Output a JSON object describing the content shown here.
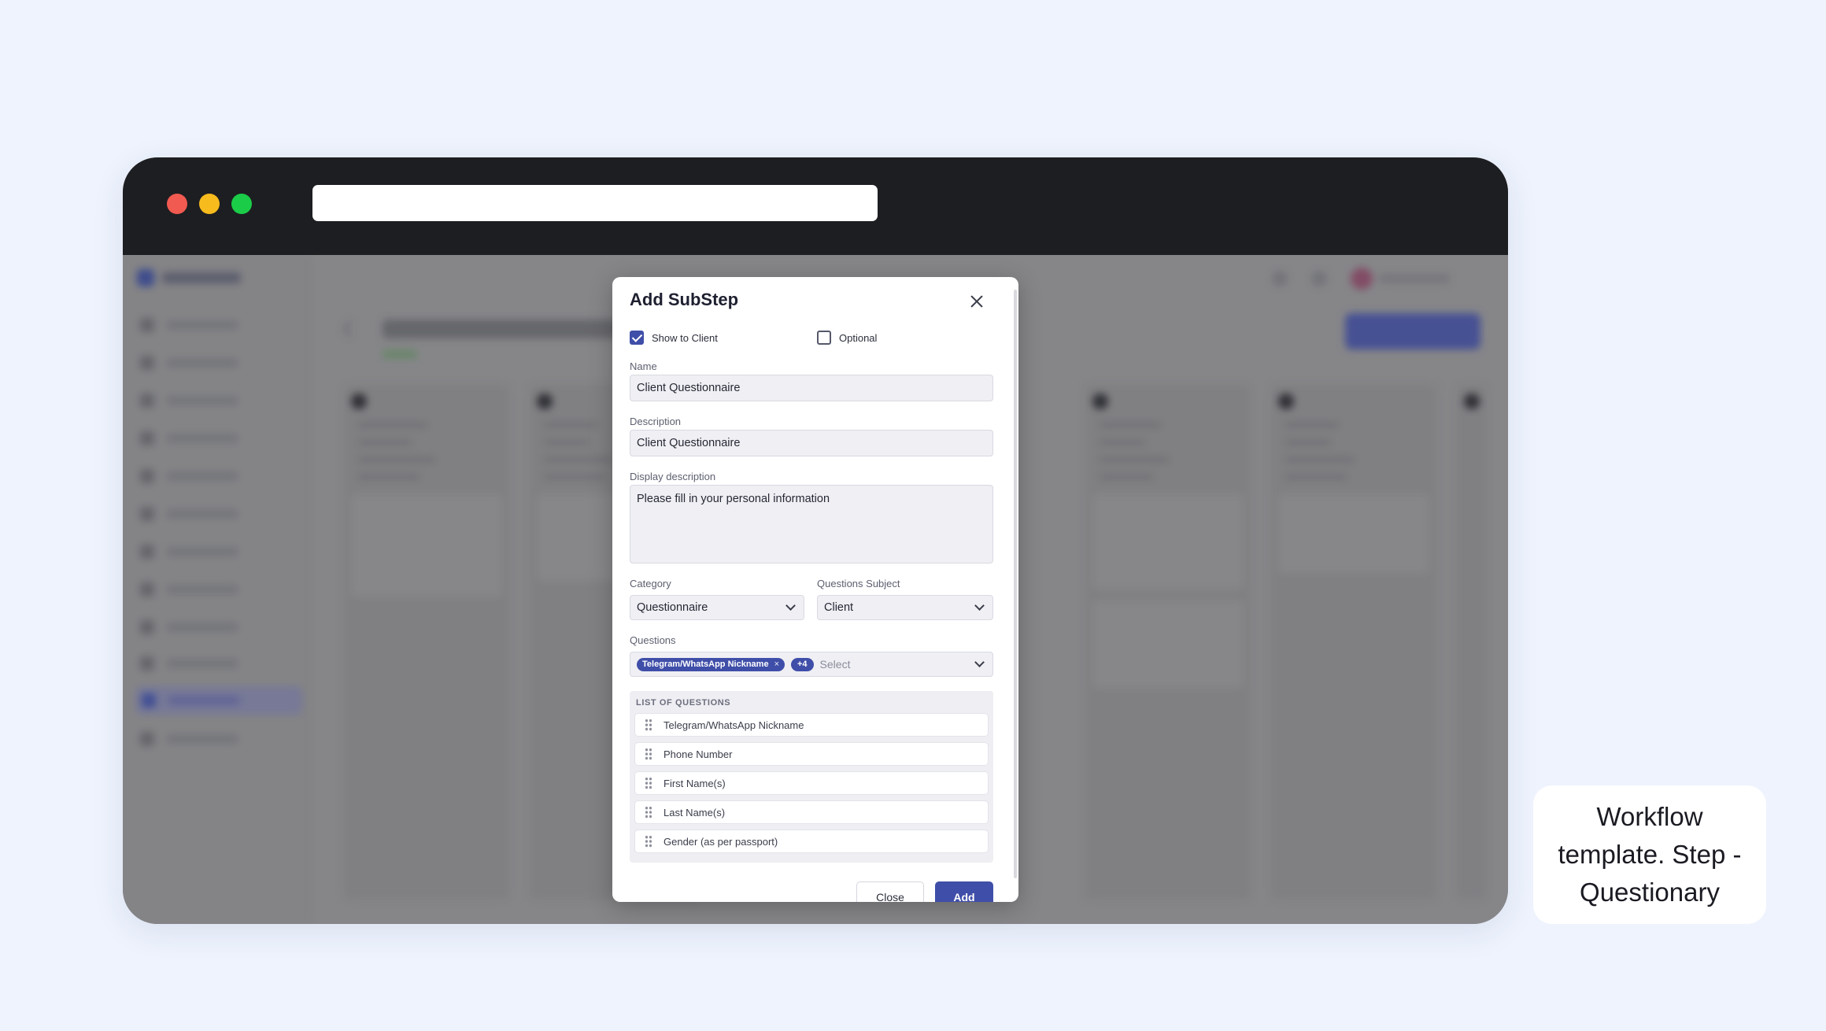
{
  "modal": {
    "title": "Add SubStep",
    "show_to_client": {
      "label": "Show to Client",
      "checked": true
    },
    "optional": {
      "label": "Optional",
      "checked": false
    },
    "name": {
      "label": "Name",
      "value": "Client Questionnaire"
    },
    "description": {
      "label": "Description",
      "value": "Client Questionnaire"
    },
    "display_description": {
      "label": "Display description",
      "value": "Please fill in your personal information"
    },
    "category": {
      "label": "Category",
      "value": "Questionnaire"
    },
    "questions_subject": {
      "label": "Questions Subject",
      "value": "Client"
    },
    "questions": {
      "label": "Questions",
      "chip": "Telegram/WhatsApp Nickname",
      "chip_remove": "×",
      "more": "+4",
      "placeholder": "Select"
    },
    "list": {
      "heading": "LIST OF QUESTIONS",
      "items": [
        "Telegram/WhatsApp Nickname",
        "Phone Number",
        "First Name(s)",
        "Last Name(s)",
        "Gender (as per passport)"
      ]
    },
    "close_label": "Close",
    "add_label": "Add"
  },
  "caption": "Workflow template. Step - Questionary",
  "colors": {
    "accent": "#3f4ea8",
    "titlebar": "#1d1e21",
    "page_bg": "#eef3fd"
  },
  "icons": [
    "close-icon",
    "checkbox-checked-icon",
    "checkbox-unchecked-icon",
    "chevron-down-icon",
    "drag-handle-icon"
  ]
}
